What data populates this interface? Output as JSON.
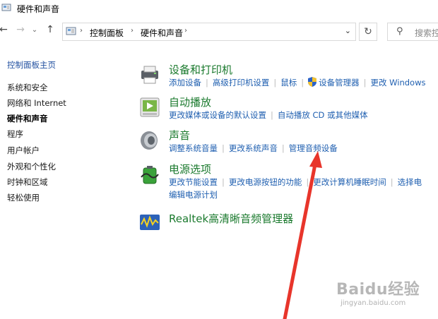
{
  "window": {
    "title": "硬件和声音"
  },
  "address_bar": {
    "crumbs": [
      "控制面板",
      "硬件和声音"
    ],
    "search_placeholder": "搜索控"
  },
  "sidebar": {
    "items": [
      {
        "label": "控制面板主页"
      },
      {
        "label": "系统和安全"
      },
      {
        "label": "网络和 Internet"
      },
      {
        "label": "硬件和声音"
      },
      {
        "label": "程序"
      },
      {
        "label": "用户帐户"
      },
      {
        "label": "外观和个性化"
      },
      {
        "label": "时钟和区域"
      },
      {
        "label": "轻松使用"
      }
    ]
  },
  "categories": [
    {
      "title": "设备和打印机",
      "icon": "printer-icon",
      "links": [
        "添加设备",
        "高级打印机设置",
        "鼠标",
        "设备管理器",
        "更改 Windows"
      ]
    },
    {
      "title": "自动播放",
      "icon": "autoplay-icon",
      "links": [
        "更改媒体或设备的默认设置",
        "自动播放 CD 或其他媒体"
      ]
    },
    {
      "title": "声音",
      "icon": "speaker-icon",
      "links": [
        "调整系统音量",
        "更改系统声音",
        "管理音频设备"
      ]
    },
    {
      "title": "电源选项",
      "icon": "battery-icon",
      "links": [
        "更改节能设置",
        "更改电源按钮的功能",
        "更改计算机睡眠时间",
        "选择电"
      ],
      "links2": [
        "编辑电源计划"
      ]
    },
    {
      "title": "Realtek高清晰音频管理器",
      "icon": "realtek-icon",
      "links": []
    }
  ],
  "watermark": {
    "text": "Baidu经验",
    "sub": "jingyan.baidu.com"
  },
  "colors": {
    "link": "#1f5fb0",
    "category_title": "#1b7a2e",
    "annotation_arrow": "#e8352b"
  }
}
